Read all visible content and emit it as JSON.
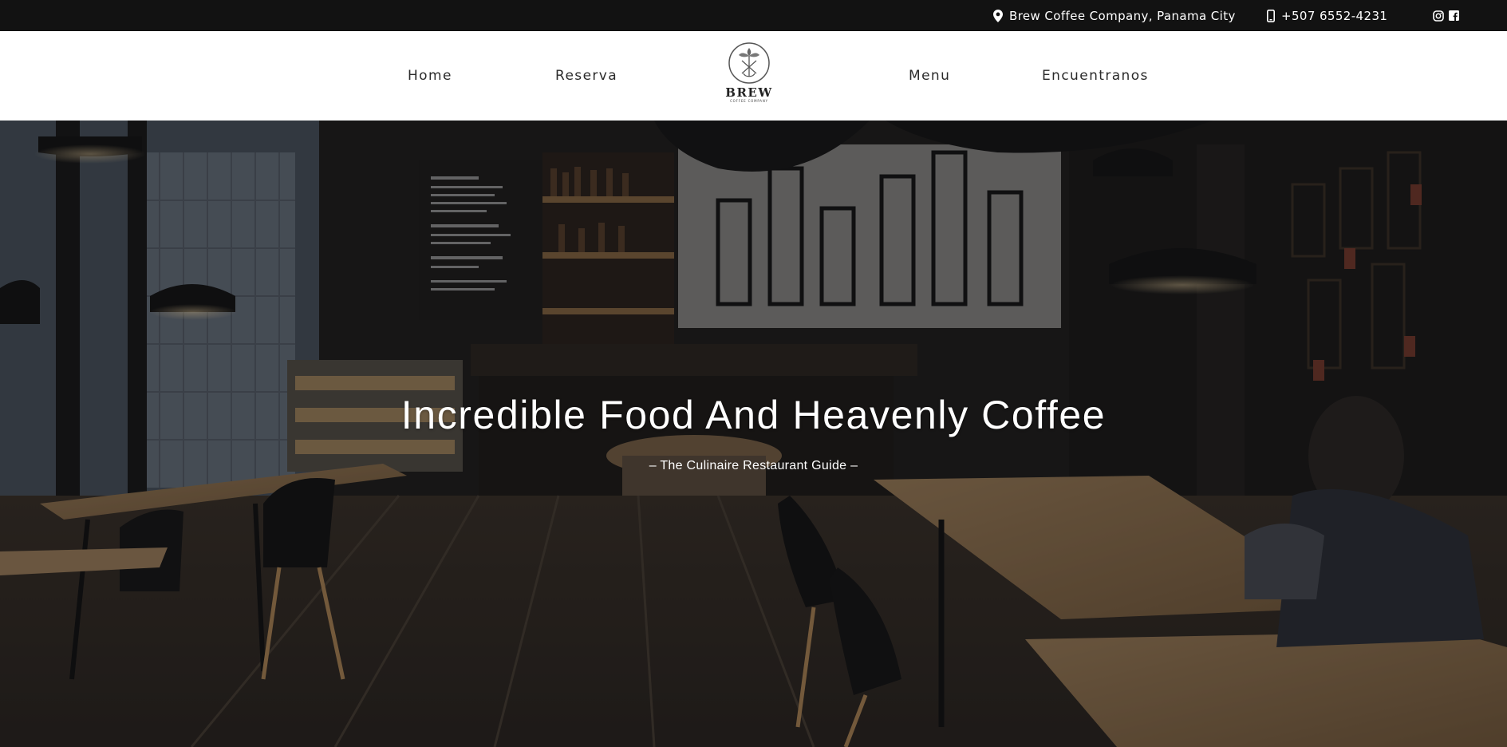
{
  "topbar": {
    "address": "Brew Coffee Company, Panama City",
    "phone": "+507 6552-4231",
    "icons": [
      "map-pin-icon",
      "phone-icon",
      "instagram-icon",
      "facebook-icon"
    ]
  },
  "nav": {
    "items": [
      {
        "label": "Home"
      },
      {
        "label": "Reserva"
      },
      {
        "label": "Menu"
      },
      {
        "label": "Encuentranos"
      }
    ],
    "logo": {
      "brand": "BREW",
      "sub": "COFFEE COMPANY"
    }
  },
  "hero": {
    "title": "Incredible Food And Heavenly Coffee",
    "subtitle": "– The Culinaire Restaurant Guide –"
  },
  "colors": {
    "topbar_bg": "#121212",
    "nav_bg": "#ffffff",
    "nav_text": "#2b2b2b",
    "hero_text": "#ffffff"
  }
}
